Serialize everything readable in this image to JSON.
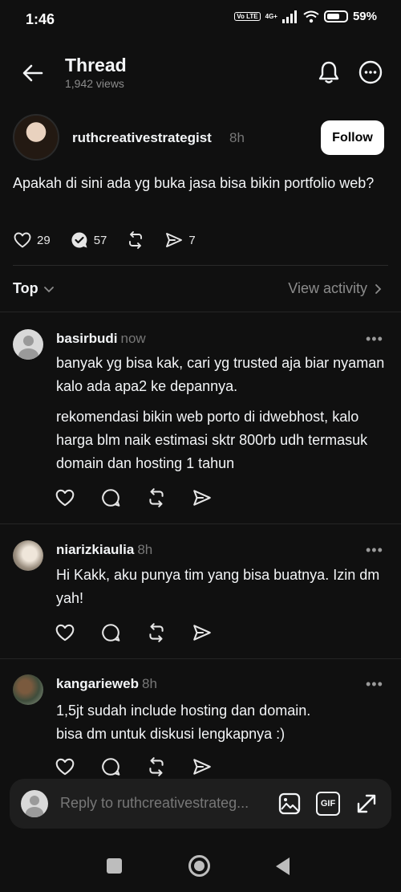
{
  "status": {
    "time": "1:46",
    "volte": "Vo LTE",
    "network": "4G+",
    "battery": "59%"
  },
  "header": {
    "title": "Thread",
    "views": "1,942 views"
  },
  "post": {
    "username": "ruthcreativestrategist",
    "time": "8h",
    "follow_label": "Follow",
    "text": "Apakah di sini ada yg buka jasa bisa bikin portfolio web?",
    "likes": "29",
    "replies": "57",
    "shares": "7"
  },
  "sort": {
    "label": "Top",
    "view_activity": "View activity"
  },
  "replies": [
    {
      "username": "basirbudi",
      "time": "now",
      "paragraphs": [
        "banyak yg bisa kak, cari yg trusted aja biar nyaman kalo ada apa2 ke depannya.",
        "rekomendasi bikin web porto di idwebhost, kalo harga blm naik estimasi sktr 800rb udh termasuk domain dan hosting 1 tahun"
      ]
    },
    {
      "username": "niarizkiaulia",
      "time": "8h",
      "paragraphs": [
        "Hi Kakk, aku punya tim yang bisa buatnya. Izin dm yah!"
      ]
    },
    {
      "username": "kangarieweb",
      "time": "8h",
      "paragraphs": [
        "1,5jt sudah include hosting dan domain.",
        "bisa dm untuk diskusi lengkapnya :)"
      ]
    }
  ],
  "composer": {
    "placeholder": "Reply to ruthcreativestrateg...",
    "gif_label": "GIF"
  },
  "icons": {
    "back": "arrow-left-icon",
    "bell": "bell-icon",
    "more": "more-horizontal-circle-icon",
    "like": "heart-icon",
    "comment": "comment-icon",
    "repost": "repost-icon",
    "share": "send-icon",
    "image": "image-icon",
    "gif": "gif-icon",
    "expand": "expand-icon"
  }
}
